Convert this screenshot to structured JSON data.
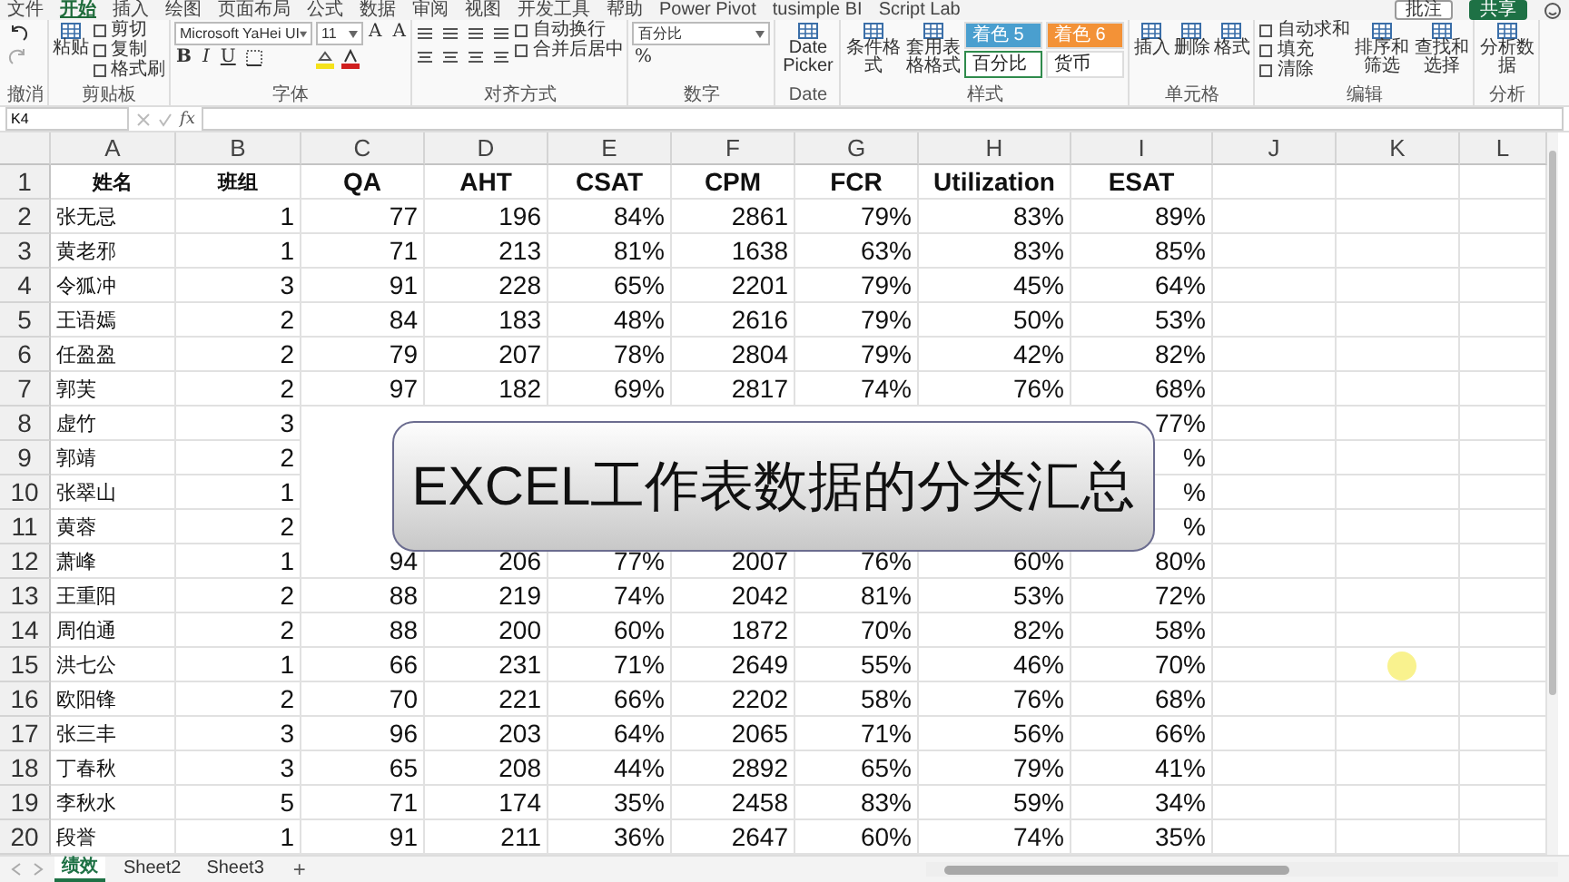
{
  "ribbon_tabs": [
    {
      "label": "文件",
      "selected": false
    },
    {
      "label": "开始",
      "selected": true
    },
    {
      "label": "插入",
      "selected": false
    },
    {
      "label": "绘图",
      "selected": false
    },
    {
      "label": "页面布局",
      "selected": false
    },
    {
      "label": "公式",
      "selected": false
    },
    {
      "label": "数据",
      "selected": false
    },
    {
      "label": "审阅",
      "selected": false
    },
    {
      "label": "视图",
      "selected": false
    },
    {
      "label": "开发工具",
      "selected": false
    },
    {
      "label": "帮助",
      "selected": false
    },
    {
      "label": "Power Pivot",
      "selected": false
    },
    {
      "label": "tusimple BI",
      "selected": false
    },
    {
      "label": "Script Lab",
      "selected": false
    }
  ],
  "top_buttons": [
    {
      "label": "批注",
      "kind": "plain"
    },
    {
      "label": "共享",
      "kind": "primary"
    }
  ],
  "ribbon_groups": [
    {
      "label": "撤消",
      "columns": [
        [
          {
            "kind": "undo"
          },
          {
            "kind": "redo"
          }
        ]
      ]
    },
    {
      "label": "剪贴板",
      "columns": [
        [
          {
            "kind": "big",
            "label": "粘贴"
          }
        ],
        [
          {
            "kind": "small",
            "label": "剪切"
          },
          {
            "kind": "small",
            "label": "复制"
          },
          {
            "kind": "small",
            "label": "格式刷"
          }
        ]
      ]
    },
    {
      "label": "字体",
      "columns": [
        [
          {
            "kind": "wide_field",
            "value": "Microsoft YaHei UI"
          },
          {
            "kind": "font_tools",
            "labels": [
              "B",
              "I",
              "U"
            ]
          }
        ],
        [
          {
            "kind": "narrow_field",
            "value": "11"
          },
          {
            "kind": "color_tools"
          }
        ],
        [
          {
            "kind": "chars",
            "labels": [
              "A",
              "A"
            ]
          }
        ]
      ]
    },
    {
      "label": "对齐方式",
      "columns": [
        [
          {
            "kind": "align_icons"
          }
        ],
        [
          {
            "kind": "small",
            "label": "自动换行"
          },
          {
            "kind": "small",
            "label": "合并后居中"
          }
        ]
      ]
    },
    {
      "label": "数字",
      "columns": [
        [
          {
            "kind": "wide_field",
            "value": "百分比"
          },
          {
            "kind": "chars",
            "labels": [
              "%"
            ]
          }
        ]
      ]
    },
    {
      "label": "Date",
      "columns": [
        [
          {
            "kind": "big",
            "label": "Date Picker"
          }
        ]
      ]
    },
    {
      "label": "样式",
      "columns": [
        [
          {
            "kind": "big",
            "label": "条件格式"
          }
        ],
        [
          {
            "kind": "big",
            "label": "套用表格格式"
          }
        ],
        [
          {
            "kind": "style",
            "label": "着色 5",
            "color": "#4a9fcf",
            "selected": false
          },
          {
            "kind": "style",
            "label": "百分比",
            "color": "#ffffff",
            "selected": true
          }
        ],
        [
          {
            "kind": "style",
            "label": "着色 6",
            "color": "#f39237",
            "selected": false
          },
          {
            "kind": "style",
            "label": "货币",
            "color": "#ffffff",
            "selected": false
          }
        ]
      ]
    },
    {
      "label": "单元格",
      "columns": [
        [
          {
            "kind": "big",
            "label": "插入"
          }
        ],
        [
          {
            "kind": "big",
            "label": "删除"
          }
        ],
        [
          {
            "kind": "big",
            "label": "格式"
          }
        ]
      ]
    },
    {
      "label": "编辑",
      "columns": [
        [
          {
            "kind": "small",
            "label": "自动求和"
          },
          {
            "kind": "small",
            "label": "填充"
          },
          {
            "kind": "small",
            "label": "清除"
          }
        ],
        [
          {
            "kind": "big",
            "label": "排序和筛选"
          }
        ],
        [
          {
            "kind": "big",
            "label": "查找和选择"
          }
        ]
      ]
    },
    {
      "label": "分析",
      "columns": [
        [
          {
            "kind": "big",
            "label": "分析数据"
          }
        ]
      ]
    }
  ],
  "formula_bar": {
    "name_box": "K4",
    "fx": "fx"
  },
  "columns": [
    "A",
    "B",
    "C",
    "D",
    "E",
    "F",
    "G",
    "H",
    "I",
    "J",
    "K",
    "L"
  ],
  "header_row": {
    "number": "1",
    "cells": [
      "姓名",
      "班组",
      "QA",
      "AHT",
      "CSAT",
      "CPM",
      "FCR",
      "Utilization",
      "ESAT"
    ]
  },
  "rows": [
    {
      "number": "2",
      "cells": [
        "张无忌",
        "1",
        "77",
        "196",
        "84%",
        "2861",
        "79%",
        "83%",
        "89%"
      ]
    },
    {
      "number": "3",
      "cells": [
        "黄老邪",
        "1",
        "71",
        "213",
        "81%",
        "1638",
        "63%",
        "83%",
        "85%"
      ]
    },
    {
      "number": "4",
      "cells": [
        "令狐冲",
        "3",
        "91",
        "228",
        "65%",
        "2201",
        "79%",
        "45%",
        "64%"
      ]
    },
    {
      "number": "5",
      "cells": [
        "王语嫣",
        "2",
        "84",
        "183",
        "48%",
        "2616",
        "79%",
        "50%",
        "53%"
      ]
    },
    {
      "number": "6",
      "cells": [
        "任盈盈",
        "2",
        "79",
        "207",
        "78%",
        "2804",
        "79%",
        "42%",
        "82%"
      ]
    },
    {
      "number": "7",
      "cells": [
        "郭芙",
        "2",
        "97",
        "182",
        "69%",
        "2817",
        "74%",
        "76%",
        "68%"
      ]
    },
    {
      "number": "8",
      "cells": [
        "虚竹",
        "3",
        null,
        null,
        null,
        null,
        null,
        null,
        "77%"
      ]
    },
    {
      "number": "9",
      "cells": [
        "郭靖",
        "2",
        null,
        null,
        null,
        null,
        null,
        null,
        "%"
      ]
    },
    {
      "number": "10",
      "cells": [
        "张翠山",
        "1",
        null,
        null,
        null,
        null,
        null,
        null,
        "%"
      ]
    },
    {
      "number": "11",
      "cells": [
        "黄蓉",
        "2",
        null,
        null,
        null,
        null,
        null,
        null,
        "%"
      ]
    },
    {
      "number": "12",
      "cells": [
        "萧峰",
        "1",
        "94",
        "206",
        "77%",
        "2007",
        "76%",
        "60%",
        "80%"
      ]
    },
    {
      "number": "13",
      "cells": [
        "王重阳",
        "2",
        "88",
        "219",
        "74%",
        "2042",
        "81%",
        "53%",
        "72%"
      ]
    },
    {
      "number": "14",
      "cells": [
        "周伯通",
        "2",
        "88",
        "200",
        "60%",
        "1872",
        "70%",
        "82%",
        "58%"
      ]
    },
    {
      "number": "15",
      "cells": [
        "洪七公",
        "1",
        "66",
        "231",
        "71%",
        "2649",
        "55%",
        "46%",
        "70%"
      ]
    },
    {
      "number": "16",
      "cells": [
        "欧阳锋",
        "2",
        "70",
        "221",
        "66%",
        "2202",
        "58%",
        "76%",
        "68%"
      ]
    },
    {
      "number": "17",
      "cells": [
        "张三丰",
        "3",
        "96",
        "203",
        "64%",
        "2065",
        "71%",
        "56%",
        "66%"
      ]
    },
    {
      "number": "18",
      "cells": [
        "丁春秋",
        "3",
        "65",
        "208",
        "44%",
        "2892",
        "65%",
        "79%",
        "41%"
      ]
    },
    {
      "number": "19",
      "cells": [
        "李秋水",
        "5",
        "71",
        "174",
        "35%",
        "2458",
        "83%",
        "59%",
        "34%"
      ]
    },
    {
      "number": "20",
      "cells": [
        "段誉",
        "1",
        "91",
        "211",
        "36%",
        "2647",
        "60%",
        "74%",
        "35%"
      ]
    }
  ],
  "overlay_title": "EXCEL工作表数据的分类汇总",
  "sheet_tabs": [
    {
      "label": "绩效",
      "selected": true
    },
    {
      "label": "Sheet2",
      "selected": false
    },
    {
      "label": "Sheet3",
      "selected": false
    }
  ],
  "add_sheet": "+"
}
